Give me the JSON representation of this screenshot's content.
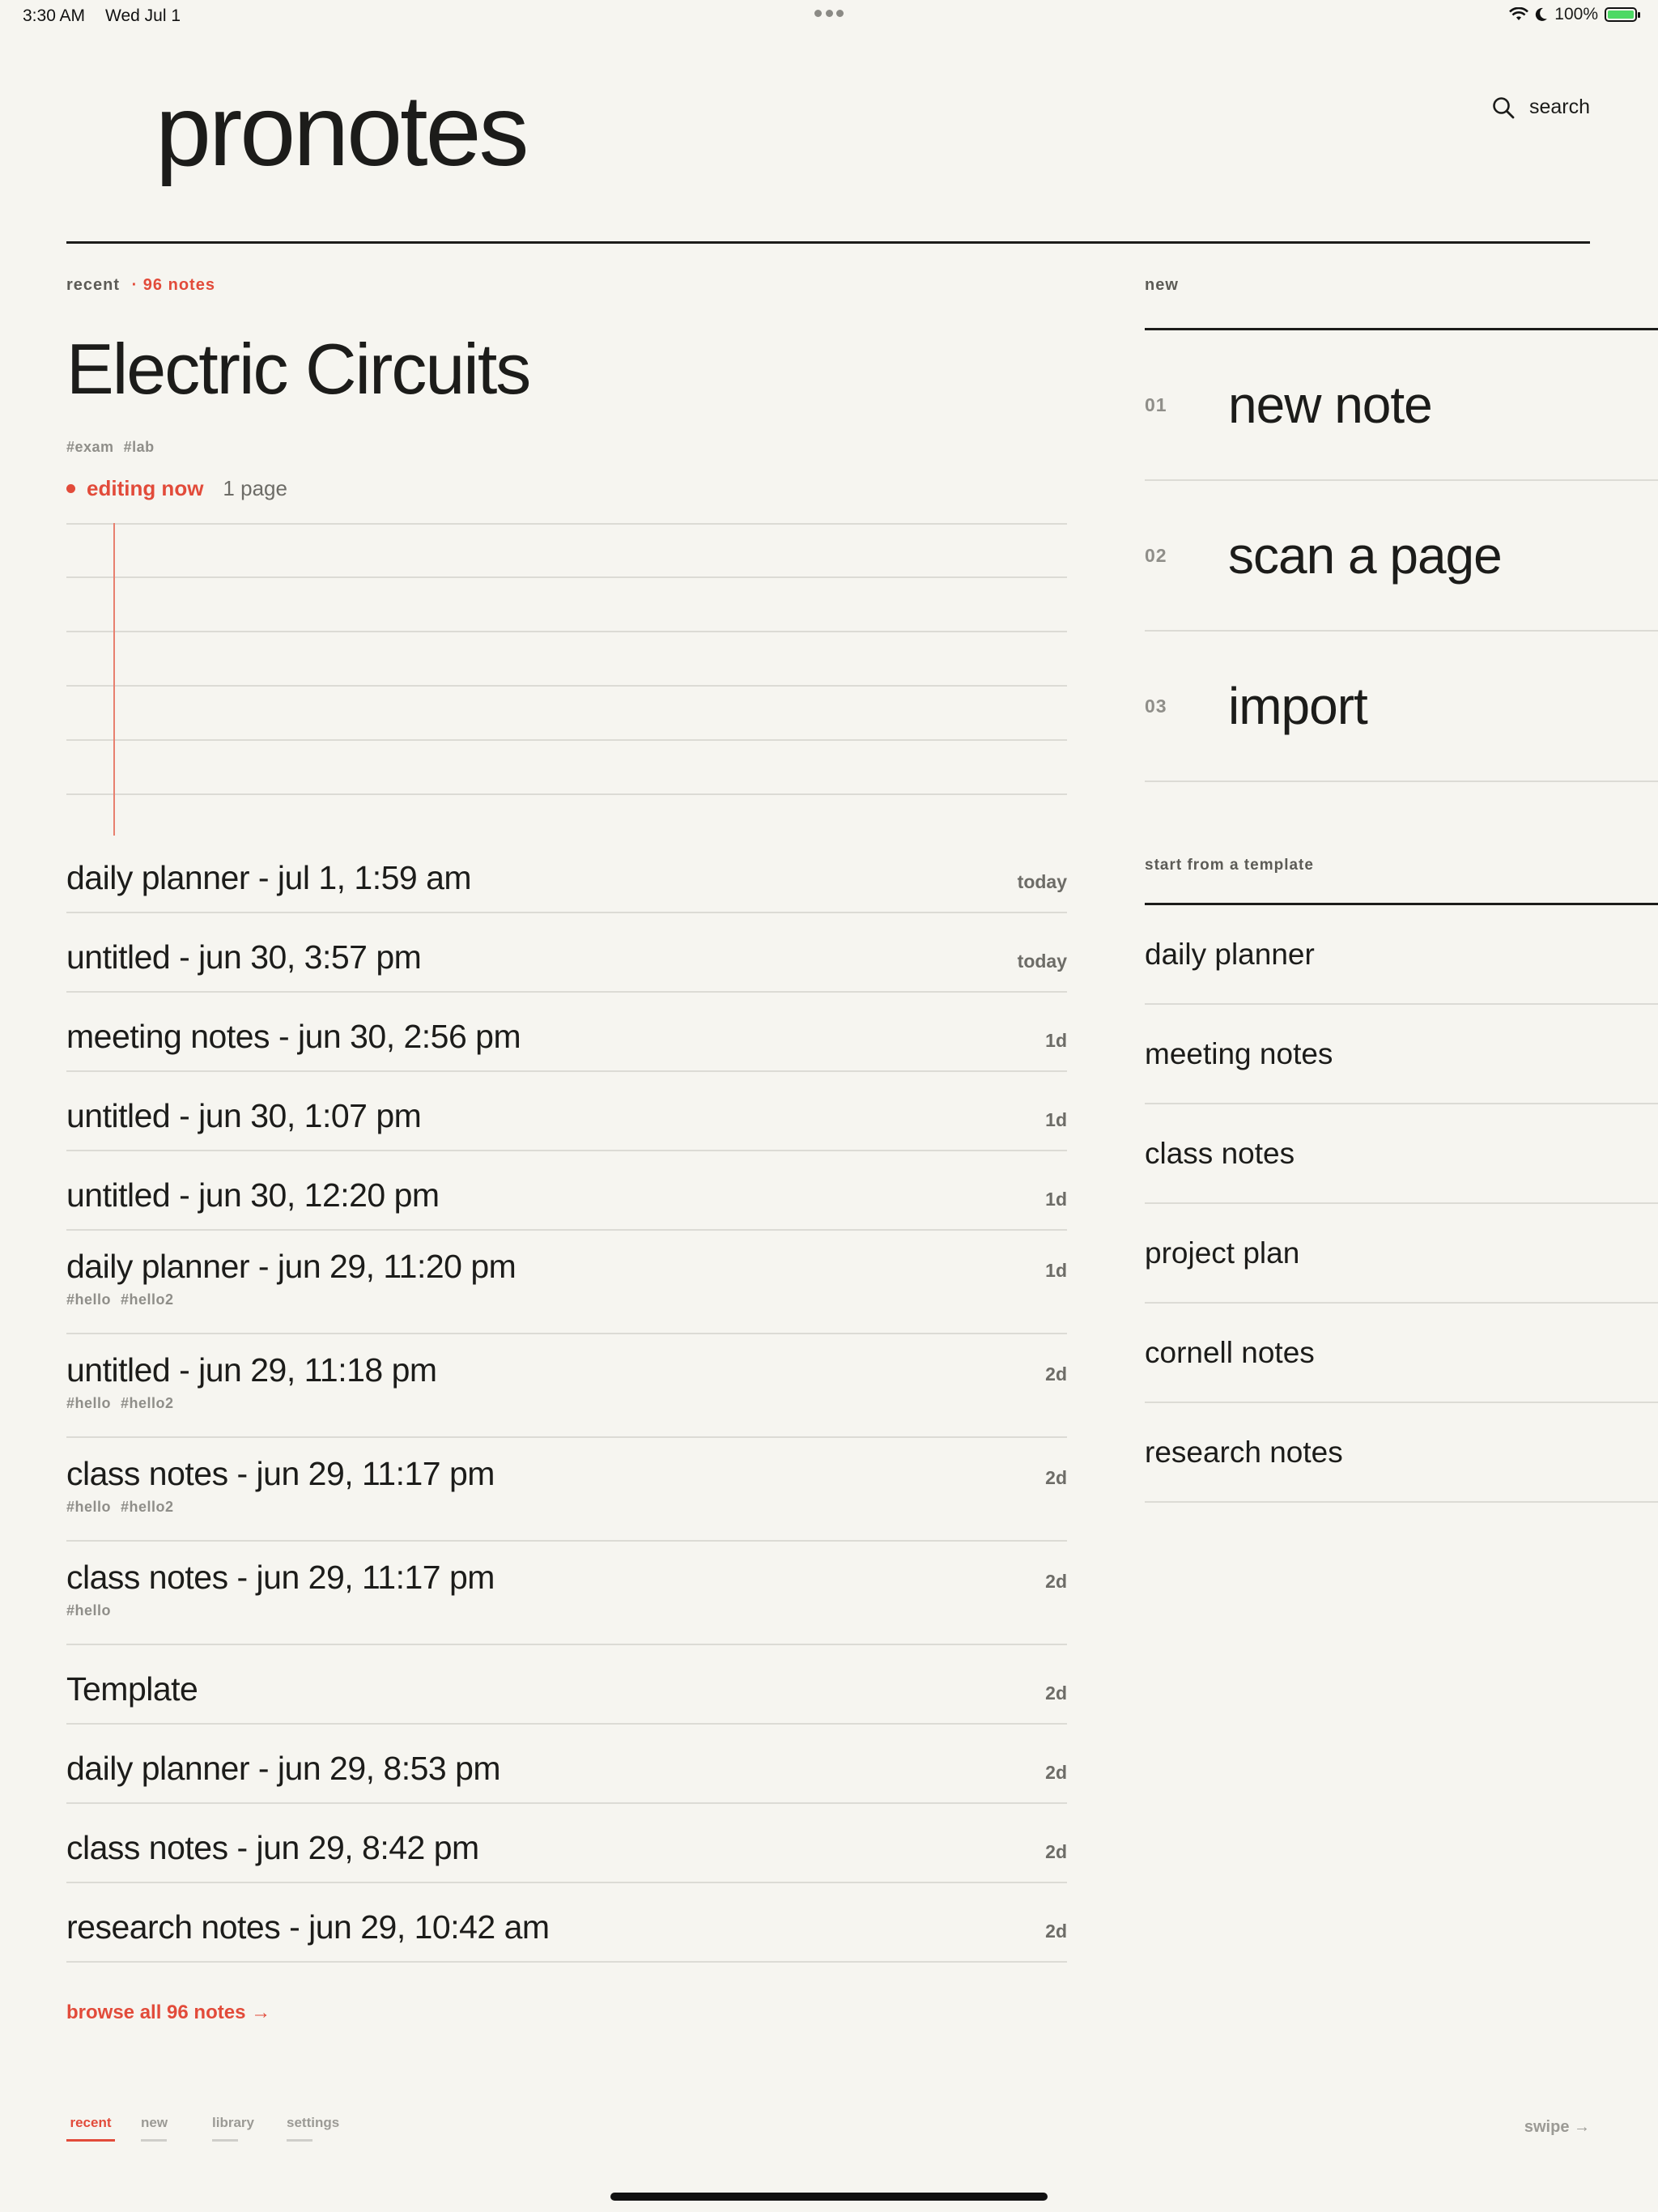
{
  "status_bar": {
    "time": "3:30 AM",
    "date": "Wed Jul 1",
    "battery": "100%"
  },
  "header": {
    "app_title": "pronotes",
    "search_label": "search"
  },
  "recent": {
    "section_label": "recent",
    "count_label": "· 96 notes",
    "featured": {
      "title": "Electric Circuits",
      "tags": [
        "#exam",
        "#lab"
      ],
      "status": "editing now",
      "pages": "1 page"
    },
    "notes": [
      {
        "title": "daily planner - jul 1, 1:59 am",
        "age": "today",
        "tags": []
      },
      {
        "title": "untitled - jun 30, 3:57 pm",
        "age": "today",
        "tags": []
      },
      {
        "title": "meeting notes - jun 30, 2:56 pm",
        "age": "1d",
        "tags": []
      },
      {
        "title": "untitled - jun 30, 1:07 pm",
        "age": "1d",
        "tags": []
      },
      {
        "title": "untitled - jun 30, 12:20 pm",
        "age": "1d",
        "tags": []
      },
      {
        "title": "daily planner - jun 29, 11:20 pm",
        "age": "1d",
        "tags": [
          "#hello",
          "#hello2"
        ]
      },
      {
        "title": "untitled - jun 29, 11:18 pm",
        "age": "2d",
        "tags": [
          "#hello",
          "#hello2"
        ]
      },
      {
        "title": "class notes - jun 29, 11:17 pm",
        "age": "2d",
        "tags": [
          "#hello",
          "#hello2"
        ]
      },
      {
        "title": "class notes - jun 29, 11:17 pm",
        "age": "2d",
        "tags": [
          "#hello"
        ]
      },
      {
        "title": "Template",
        "age": "2d",
        "tags": []
      },
      {
        "title": "daily planner - jun 29, 8:53 pm",
        "age": "2d",
        "tags": []
      },
      {
        "title": "class notes - jun 29, 8:42 pm",
        "age": "2d",
        "tags": []
      },
      {
        "title": "research notes - jun 29, 10:42 am",
        "age": "2d",
        "tags": []
      }
    ],
    "browse_all": "browse all 96 notes →"
  },
  "new_section": {
    "label": "new",
    "items": [
      {
        "num": "01",
        "label": "new note"
      },
      {
        "num": "02",
        "label": "scan a page"
      },
      {
        "num": "03",
        "label": "import"
      }
    ],
    "template_label": "start from a template",
    "templates": [
      "daily planner",
      "meeting notes",
      "class notes",
      "project plan",
      "cornell notes",
      "research notes"
    ]
  },
  "bottom_nav": {
    "tabs": [
      {
        "label": "recent",
        "active": true
      },
      {
        "label": "new",
        "active": false
      },
      {
        "label": "library",
        "active": false
      },
      {
        "label": "settings",
        "active": false
      }
    ],
    "swipe_label": "swipe →"
  },
  "colors": {
    "accent": "#e24b3a",
    "background": "#f6f5f0",
    "text": "#1c1c1a"
  }
}
